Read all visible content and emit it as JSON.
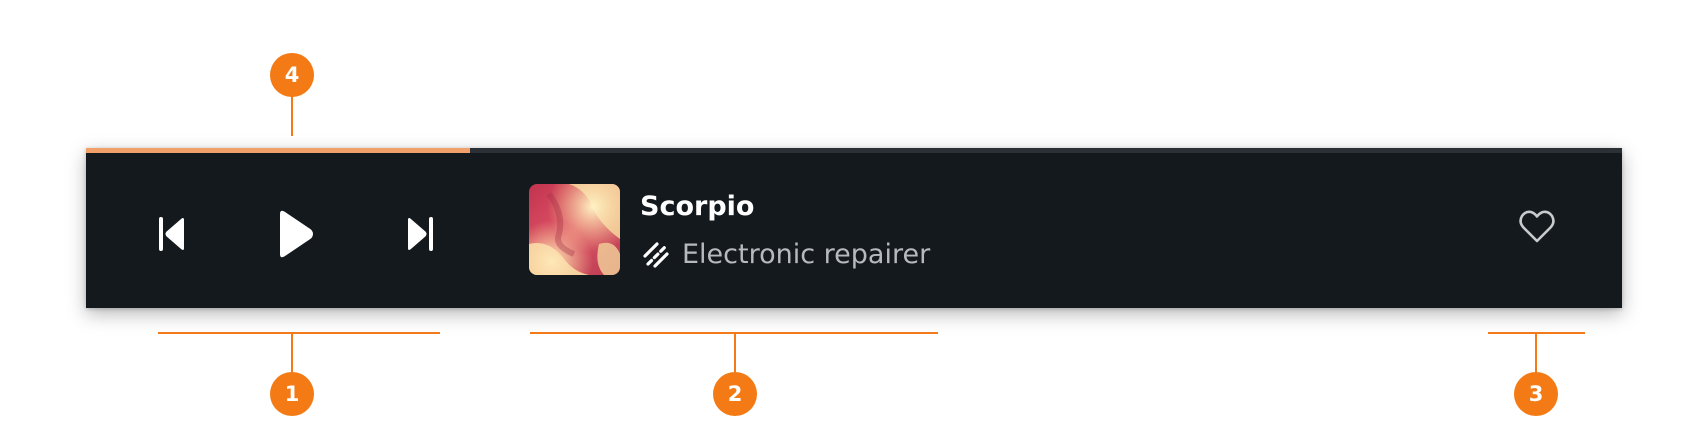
{
  "player": {
    "progress_fraction": 0.25,
    "track_title": "Scorpio",
    "artist": "Electronic repairer",
    "controls": {
      "previous_icon": "skip-previous-icon",
      "play_icon": "play-icon",
      "next_icon": "skip-next-icon"
    },
    "artist_icon": "edit-slash-icon",
    "favorite_icon": "heart-outline-icon"
  },
  "callouts": [
    {
      "label": "1"
    },
    {
      "label": "2"
    },
    {
      "label": "3"
    },
    {
      "label": "4"
    }
  ],
  "colors": {
    "bar_background": "#14191e",
    "progress": "#f2a06a",
    "accent": "#f37a14",
    "title": "#ffffff",
    "artist": "#b7babd"
  }
}
